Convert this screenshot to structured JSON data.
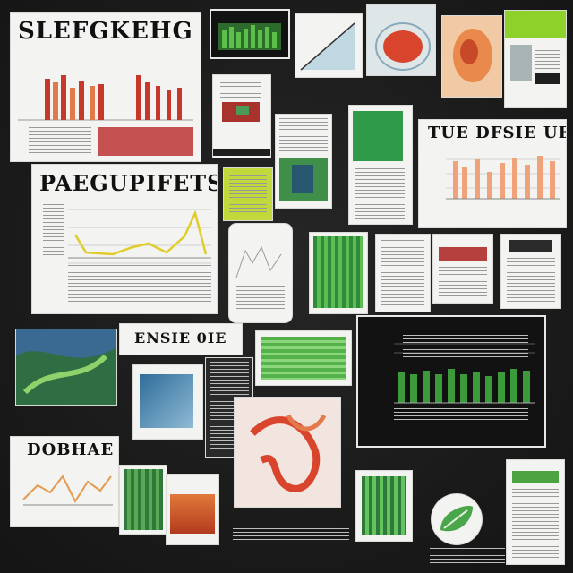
{
  "headings": {
    "top_left": "SLEFGKEHG",
    "line_chart": "PAEGUPIFETSA",
    "right_bars": "TUE DFSIE UBBE",
    "mid_strip": "ENSIE 0IE",
    "bottom_left": "DOBHAE"
  },
  "palette": {
    "board": "#1b1b1b",
    "paper": "#f3f3f1",
    "accent_green": "#3d9a3a",
    "accent_red": "#c8372b",
    "accent_orange": "#f0a27a",
    "accent_yellow": "#e0cc2a",
    "accent_lime": "#8ed12b"
  },
  "icons": [
    "leaf-icon",
    "heart-anatomy-icon"
  ]
}
